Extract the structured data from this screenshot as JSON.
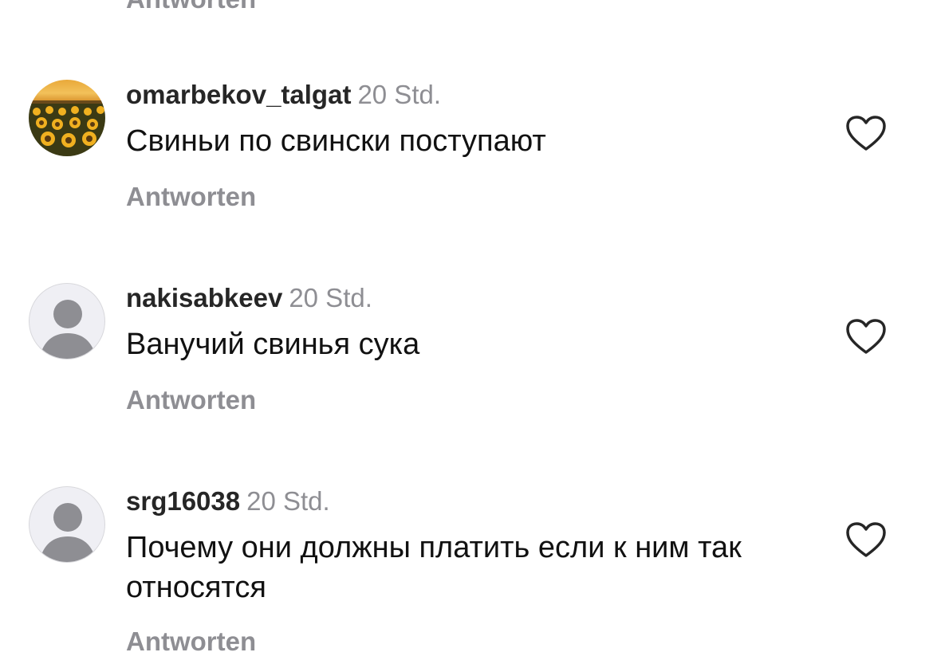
{
  "partial_reply_label": "Antworten",
  "comments": [
    {
      "username": "omarbekov_talgat",
      "time": "20 Std.",
      "text": "Свиньи по свински поступают",
      "reply_label": "Antworten",
      "avatar": "sunflower-field-photo"
    },
    {
      "username": "nakisabkeev",
      "time": "20 Std.",
      "text": "Ванучий свинья сука",
      "reply_label": "Antworten",
      "avatar": "default-user-icon"
    },
    {
      "username": "srg16038",
      "time": "20 Std.",
      "text": "Почему они должны платить если к ним так относятся",
      "reply_label": "Antworten",
      "avatar": "default-user-icon"
    }
  ],
  "colors": {
    "username": "#262626",
    "meta_gray": "#8e8e93",
    "text": "#111111",
    "heart": "#262626",
    "avatar_placeholder_bg": "#efeff4",
    "avatar_placeholder_icon": "#8e8e93"
  }
}
